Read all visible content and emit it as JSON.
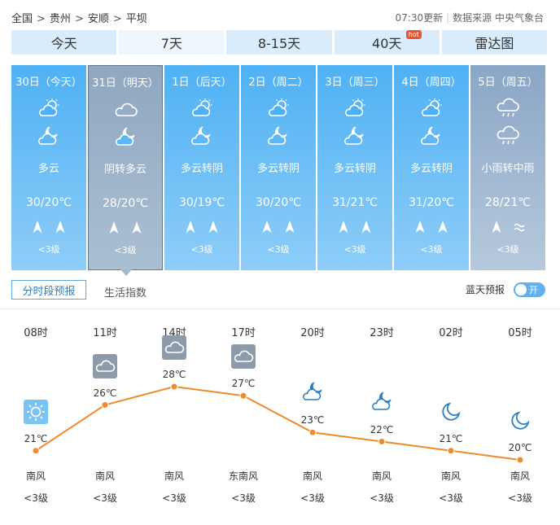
{
  "breadcrumb": [
    "全国",
    "贵州",
    "安顺",
    "平坝"
  ],
  "update_time": "07:30更新",
  "data_source": "数据来源 中央气象台",
  "tabs": [
    {
      "label": "今天"
    },
    {
      "label": "7天",
      "active": true
    },
    {
      "label": "8-15天"
    },
    {
      "label": "40天",
      "badge": "hot"
    },
    {
      "label": "雷达图"
    }
  ],
  "days": [
    {
      "label": "30日（今天）",
      "icon_day": "partly-cloudy-sun-icon",
      "icon_night": "partly-cloudy-moon-icon",
      "desc": "多云",
      "temp": "30/20℃",
      "wind_icons": [
        "wind-arrow-icon",
        "wind-arrow-icon"
      ],
      "wind_level": "<3级"
    },
    {
      "label": "31日（明天）",
      "icon_day": "cloud-icon",
      "icon_night": "partly-cloudy-moon-icon",
      "desc": "阴转多云",
      "temp": "28/20℃",
      "wind_icons": [
        "wind-arrow-icon",
        "wind-arrow-icon"
      ],
      "wind_level": "<3级",
      "selected": true
    },
    {
      "label": "1日（后天）",
      "icon_day": "partly-cloudy-sun-icon",
      "icon_night": "partly-cloudy-moon-icon",
      "desc": "多云转阴",
      "temp": "30/19℃",
      "wind_icons": [
        "wind-arrow-icon",
        "wind-arrow-icon"
      ],
      "wind_level": "<3级"
    },
    {
      "label": "2日（周二）",
      "icon_day": "partly-cloudy-sun-icon",
      "icon_night": "partly-cloudy-moon-icon",
      "desc": "多云转阴",
      "temp": "30/20℃",
      "wind_icons": [
        "wind-arrow-icon",
        "wind-arrow-icon"
      ],
      "wind_level": "<3级"
    },
    {
      "label": "3日（周三）",
      "icon_day": "partly-cloudy-sun-icon",
      "icon_night": "partly-cloudy-moon-icon",
      "desc": "多云转阴",
      "temp": "31/21℃",
      "wind_icons": [
        "wind-arrow-icon",
        "wind-arrow-icon"
      ],
      "wind_level": "<3级"
    },
    {
      "label": "4日（周四）",
      "icon_day": "partly-cloudy-sun-icon",
      "icon_night": "partly-cloudy-moon-icon",
      "desc": "多云转阴",
      "temp": "31/20℃",
      "wind_icons": [
        "wind-arrow-icon",
        "wind-arrow-icon"
      ],
      "wind_level": "<3级"
    },
    {
      "label": "5日（周五）",
      "icon_day": "rain-cloud-icon",
      "icon_night": "rain-cloud-icon",
      "desc": "小雨转中雨",
      "temp": "28/21℃",
      "wind_icons": [
        "wind-arrow-icon",
        "breeze-icon"
      ],
      "wind_level": "<3级",
      "gray": true
    }
  ],
  "subtabs": {
    "hourly": "分时段预报",
    "life": "生活指数"
  },
  "blue_sky": {
    "label": "蓝天预报",
    "toggle": "开"
  },
  "hourly": [
    {
      "time": "08时",
      "icon": "sun-icon",
      "temp": 21,
      "temp_label": "21℃",
      "wind_dir": "南风",
      "wind_level": "<3级"
    },
    {
      "time": "11时",
      "icon": "cloud-icon",
      "temp": 26,
      "temp_label": "26℃",
      "wind_dir": "南风",
      "wind_level": "<3级"
    },
    {
      "time": "14时",
      "icon": "cloud-icon",
      "temp": 28,
      "temp_label": "28℃",
      "wind_dir": "南风",
      "wind_level": "<3级"
    },
    {
      "time": "17时",
      "icon": "cloud-icon",
      "temp": 27,
      "temp_label": "27℃",
      "wind_dir": "东南风",
      "wind_level": "<3级"
    },
    {
      "time": "20时",
      "icon": "partly-cloudy-moon-icon",
      "temp": 23,
      "temp_label": "23℃",
      "wind_dir": "南风",
      "wind_level": "<3级"
    },
    {
      "time": "23时",
      "icon": "partly-cloudy-moon-icon",
      "temp": 22,
      "temp_label": "22℃",
      "wind_dir": "南风",
      "wind_level": "<3级"
    },
    {
      "time": "02时",
      "icon": "moon-icon",
      "temp": 21,
      "temp_label": "21℃",
      "wind_dir": "南风",
      "wind_level": "<3级"
    },
    {
      "time": "05时",
      "icon": "moon-icon",
      "temp": 20,
      "temp_label": "20℃",
      "wind_dir": "南风",
      "wind_level": "<3级"
    }
  ],
  "colors": {
    "day_card": "#4fb1f4",
    "selected_card": "#8fa8c0",
    "curve": "#ef8a2e",
    "tab": "#d8ecfb"
  }
}
